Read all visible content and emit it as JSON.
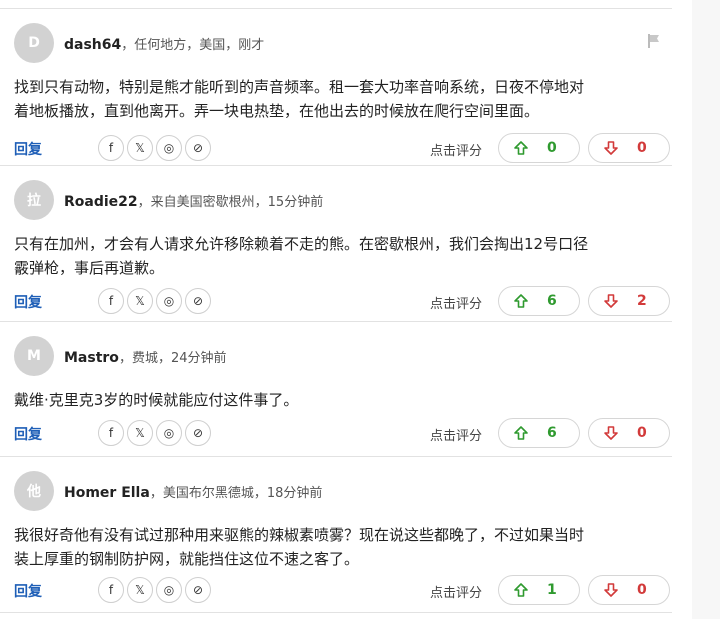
{
  "comments": [
    {
      "avatar_initial": "D",
      "author": "dash64",
      "meta": "，任何地方，美国，刚才",
      "text_lines": [
        "找到只有动物，特别是熊才能听到的声音频率。租一套大功率音响系统，日夜不停地对",
        "着地板播放，直到他离开。弄一块电热垫，在他出去的时候放在爬行空间里面。"
      ],
      "reply_label": "回复",
      "rate_label": "点击评分",
      "upvotes": "0",
      "downvotes": "0",
      "show_flag": true
    },
    {
      "avatar_initial": "拉",
      "author": "Roadie22",
      "meta": "，来自美国密歇根州，15分钟前",
      "text_lines": [
        "只有在加州，才会有人请求允许移除赖着不走的熊。在密歇根州，我们会掏出12号口径",
        "霰弹枪，事后再道歉。"
      ],
      "reply_label": "回复",
      "rate_label": "点击评分",
      "upvotes": "6",
      "downvotes": "2",
      "show_flag": false
    },
    {
      "avatar_initial": "M",
      "author": "Mastro",
      "meta": "，费城，24分钟前",
      "text_lines": [
        "戴维·克里克3岁的时候就能应付这件事了。"
      ],
      "reply_label": "回复",
      "rate_label": "点击评分",
      "upvotes": "6",
      "downvotes": "0",
      "show_flag": false
    },
    {
      "avatar_initial": "他",
      "author": "Homer Ella",
      "meta": "，美国布尔黑德城，18分钟前",
      "text_lines": [
        "我很好奇他有没有试过那种用来驱熊的辣椒素喷雾？现在说这些都晚了，不过如果当时",
        "装上厚重的钢制防护网，就能挡住这位不速之客了。"
      ],
      "reply_label": "回复",
      "rate_label": "点击评分",
      "upvotes": "1",
      "downvotes": "0",
      "show_flag": false
    }
  ],
  "share_icons": [
    "facebook-icon",
    "x-icon",
    "whatsapp-icon",
    "link-icon"
  ],
  "colors": {
    "reply": "#1f5fb7",
    "up": "#2f9a2f",
    "down": "#d23a3a",
    "avatar_bg": "#d2d2d2"
  }
}
